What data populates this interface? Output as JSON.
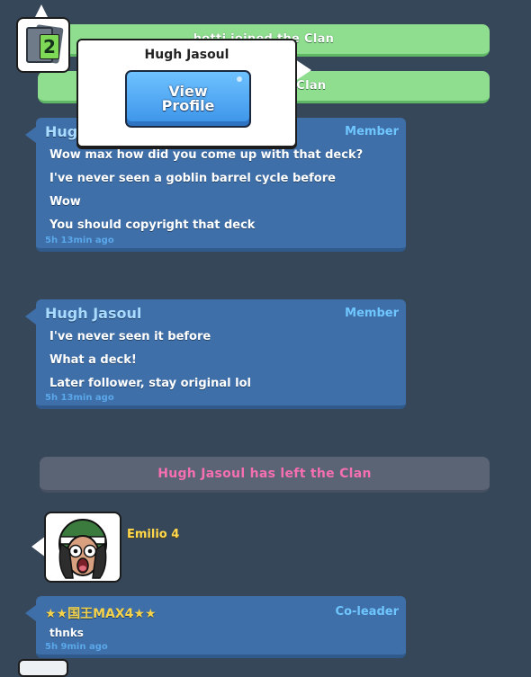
{
  "banners": {
    "joined_1": "hotti joined the Clan",
    "joined_2": "lili joined the Clan",
    "left": "Hugh Jasoul has left the Clan"
  },
  "popup": {
    "title": "Hugh Jasoul",
    "button_line1": "View",
    "button_line2": "Profile"
  },
  "badge": {
    "number": "2"
  },
  "messages": [
    {
      "name": "Hugh Jasoul",
      "role": "Member",
      "lines": [
        "Wow max how did you come up with that deck?",
        "I've never seen a goblin barrel cycle before",
        "Wow",
        "You should copyright that deck"
      ],
      "time": "5h 13min ago"
    },
    {
      "name": "Hugh Jasoul",
      "role": "Member",
      "lines": [
        "I've never seen it before",
        "What a deck!",
        "Later follower, stay original lol"
      ],
      "time": "5h 13min ago"
    },
    {
      "name": "★★国王MAX4★★",
      "role": "Co-leader",
      "lines": [
        "thnks"
      ],
      "time": "5h 9min ago"
    }
  ],
  "avatar_user": {
    "name": "Emilio 4"
  },
  "colors": {
    "background": "#37475a",
    "card": "#3f6fa8",
    "banner_green": "#8fde8f",
    "left_text": "#f66fb0",
    "name": "#a8dbff",
    "role": "#6fc6ff"
  }
}
